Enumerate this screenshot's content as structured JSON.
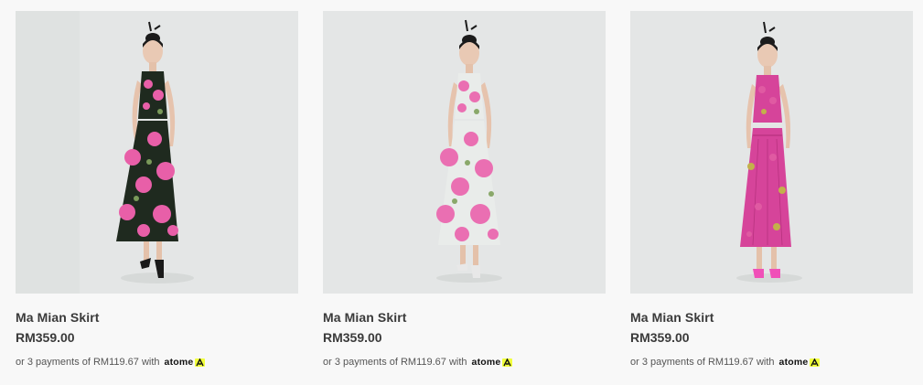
{
  "products": [
    {
      "name": "Ma Mian Skirt",
      "price": "RM359.00",
      "installment_prefix": "or 3 payments of RM119.67 with",
      "installment_brand": "atome",
      "dress_color": "#e85fa8",
      "dress_bg_color": "#1f2a1f",
      "shoe_color": "#1a1a1a"
    },
    {
      "name": "Ma Mian Skirt",
      "price": "RM359.00",
      "installment_prefix": "or 3 payments of RM119.67 with",
      "installment_brand": "atome",
      "dress_color": "#ea6fb2",
      "dress_bg_color": "#e9ecea",
      "shoe_color": "#e8e8e8"
    },
    {
      "name": "Ma Mian Skirt",
      "price": "RM359.00",
      "installment_prefix": "or 3 payments of RM119.67 with",
      "installment_brand": "atome",
      "dress_color": "#e05aa2",
      "dress_bg_color": "#d6449a",
      "shoe_color": "#f050b8"
    }
  ],
  "colors": {
    "photo_bg": "#e4e6e6",
    "logo_yellow": "#f1ff3b",
    "text": "#3a3a3a"
  }
}
